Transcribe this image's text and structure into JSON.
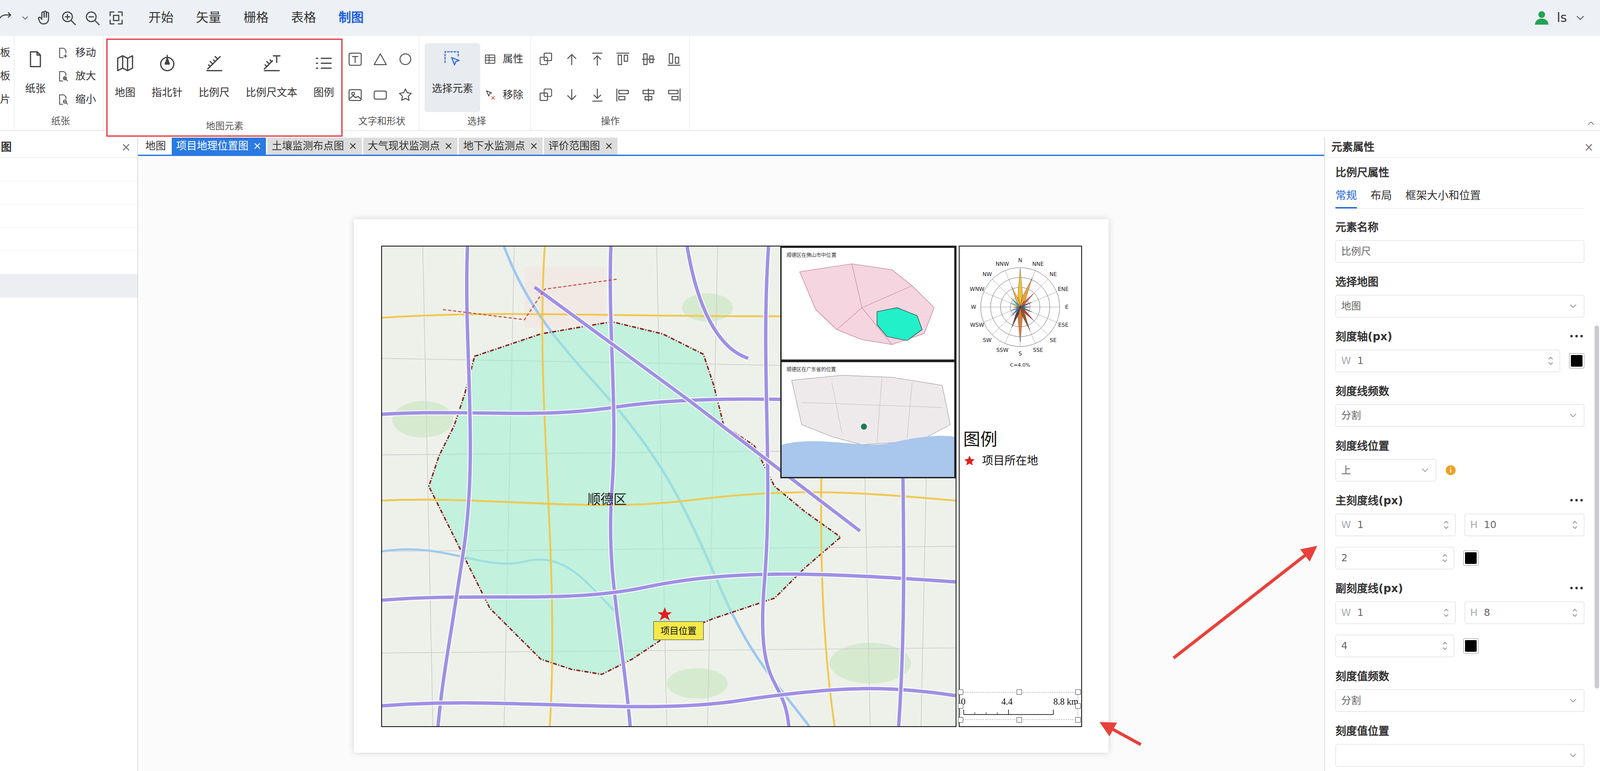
{
  "menubar": {
    "items": [
      {
        "label": "开始",
        "selected": false
      },
      {
        "label": "矢量",
        "selected": false
      },
      {
        "label": "栅格",
        "selected": false
      },
      {
        "label": "表格",
        "selected": false
      },
      {
        "label": "制图",
        "selected": true
      }
    ],
    "user": "ls"
  },
  "ribbon": {
    "cut_group": {
      "items": [
        "板",
        "板",
        "片"
      ]
    },
    "paper": {
      "label": "纸张",
      "main": "纸张",
      "items": [
        "移动",
        "放大",
        "缩小"
      ]
    },
    "elements": {
      "label": "地图元素",
      "highlighted": true,
      "items": [
        "地图",
        "指北针",
        "比例尺",
        "比例尺文本",
        "图例"
      ]
    },
    "shapes": {
      "label": "文字和形状"
    },
    "select": {
      "label": "选择",
      "main": {
        "label": "选择元素",
        "selected": true
      },
      "items": [
        "属性",
        "移除"
      ]
    },
    "ops": {
      "label": "操作"
    }
  },
  "left_panel": {
    "title": "图",
    "close": "×",
    "rows": [
      {
        "selected": false
      },
      {
        "selected": false
      },
      {
        "selected": false
      },
      {
        "selected": false
      },
      {
        "selected": false
      },
      {
        "selected": true
      }
    ]
  },
  "doc_tab_close": "×",
  "doc_tabs": [
    {
      "label": "地图",
      "selected": false,
      "closable": false
    },
    {
      "label": "项目地理位置图",
      "selected": true,
      "closable": true
    },
    {
      "label": "土壤监测布点图",
      "selected": false,
      "closable": true
    },
    {
      "label": "大气现状监测点",
      "selected": false,
      "closable": true
    },
    {
      "label": "地下水监测点",
      "selected": false,
      "closable": true
    },
    {
      "label": "评价范围图",
      "selected": false,
      "closable": true
    }
  ],
  "layout": {
    "map": {
      "region_label": "顺德区",
      "marker_label": "项目位置",
      "insets": [
        {
          "title": "顺德区在佛山市中位置"
        },
        {
          "title": "顺德区在广东省的位置"
        }
      ]
    },
    "windrose": {
      "calm": "C=4.0%",
      "directions": [
        {
          "label": "N",
          "value": 12,
          "color": "#f2c230"
        },
        {
          "label": "NNE",
          "value": 10,
          "color": "#e8a33d"
        },
        {
          "label": "NE",
          "value": 6,
          "color": "#d35f2d"
        },
        {
          "label": "ENE",
          "value": 4,
          "color": "#7b4fa0"
        },
        {
          "label": "E",
          "value": 3,
          "color": "#3a5ba8"
        },
        {
          "label": "ESE",
          "value": 4,
          "color": "#2e8b57"
        },
        {
          "label": "SE",
          "value": 6,
          "color": "#c0392b"
        },
        {
          "label": "SSE",
          "value": 8,
          "color": "#8e5a2b"
        },
        {
          "label": "S",
          "value": 11,
          "color": "#e07b39"
        },
        {
          "label": "SSW",
          "value": 7,
          "color": "#5d4037"
        },
        {
          "label": "SW",
          "value": 4,
          "color": "#1f77b4"
        },
        {
          "label": "WSW",
          "value": 3,
          "color": "#9467bd"
        },
        {
          "label": "W",
          "value": 2,
          "color": "#7f7f7f"
        },
        {
          "label": "WNW",
          "value": 3,
          "color": "#bcbd22"
        },
        {
          "label": "NW",
          "value": 4,
          "color": "#17becf"
        },
        {
          "label": "NNW",
          "value": 7,
          "color": "#f5b041"
        }
      ]
    },
    "legend": {
      "title": "图例",
      "items": [
        {
          "label": "项目所在地"
        }
      ]
    },
    "scalebar": {
      "selected": true,
      "ticks": [
        "0",
        "4.4",
        "8.8 km"
      ]
    }
  },
  "properties": {
    "title": "元素属性",
    "close": "×",
    "subtitle": "比例尺属性",
    "tabs": [
      {
        "label": "常规",
        "selected": true
      },
      {
        "label": "布局",
        "selected": false
      },
      {
        "label": "框架大小和位置",
        "selected": false
      }
    ],
    "fields": [
      {
        "kind": "input",
        "label": "元素名称",
        "value": "比例尺"
      },
      {
        "kind": "select",
        "label": "选择地图",
        "value": "地图"
      },
      {
        "kind": "stroke",
        "label": "刻度轴(px)",
        "more": "•••",
        "w_label": "W",
        "w": "1",
        "color": "#000000"
      },
      {
        "kind": "select",
        "label": "刻度线频数",
        "value": "分割"
      },
      {
        "kind": "small-select",
        "label": "刻度线位置",
        "value": "上"
      },
      {
        "kind": "tick",
        "label": "主刻度线(px)",
        "more": "•••",
        "w_label": "W",
        "w": "1",
        "h_label": "H",
        "h": "10",
        "offset": "2",
        "color": "#000000"
      },
      {
        "kind": "tick",
        "label": "副刻度线(px)",
        "more": "•••",
        "w_label": "W",
        "w": "1",
        "h_label": "H",
        "h": "8",
        "offset": "4",
        "color": "#000000"
      },
      {
        "kind": "select",
        "label": "刻度值频数",
        "value": "分割"
      },
      {
        "kind": "cut",
        "label": "刻度值位置"
      }
    ]
  }
}
